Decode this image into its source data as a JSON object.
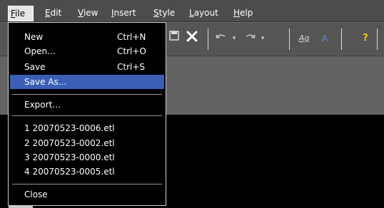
{
  "menubar": {
    "items": [
      {
        "prefix": "",
        "key": "F",
        "rest": "ile"
      },
      {
        "prefix": "",
        "key": "E",
        "rest": "dit"
      },
      {
        "prefix": "",
        "key": "V",
        "rest": "iew"
      },
      {
        "prefix": "",
        "key": "I",
        "rest": "nsert"
      },
      {
        "prefix": "",
        "key": "S",
        "rest": "tyle"
      },
      {
        "prefix": "",
        "key": "L",
        "rest": "ayout"
      },
      {
        "prefix": "",
        "key": "H",
        "rest": "elp"
      }
    ]
  },
  "toolbar": {
    "icons": [
      "save-icon",
      "delete-icon",
      "undo-icon",
      "undo-dropdown-icon",
      "redo-icon",
      "redo-dropdown-icon",
      "font-style-icon",
      "font-color-icon",
      "help-icon"
    ]
  },
  "file_menu": {
    "items": [
      {
        "label": "New",
        "shortcut": "Ctrl+N"
      },
      {
        "label": "Open...",
        "shortcut": "Ctrl+O"
      },
      {
        "label": "Save",
        "shortcut": "Ctrl+S"
      },
      {
        "label": "Save As...",
        "shortcut": ""
      },
      {
        "label": "Export...",
        "shortcut": ""
      },
      {
        "label": "1 20070523-0006.etl",
        "shortcut": ""
      },
      {
        "label": "2 20070523-0002.etl",
        "shortcut": ""
      },
      {
        "label": "3 20070523-0000.etl",
        "shortcut": ""
      },
      {
        "label": "4 20070523-0005.etl",
        "shortcut": ""
      },
      {
        "label": "Close",
        "shortcut": ""
      }
    ],
    "selected": "Save As..."
  },
  "colors": {
    "menubar": "#4c4c4c",
    "selection": "#3a5fb4",
    "toolbar": "#555555"
  }
}
